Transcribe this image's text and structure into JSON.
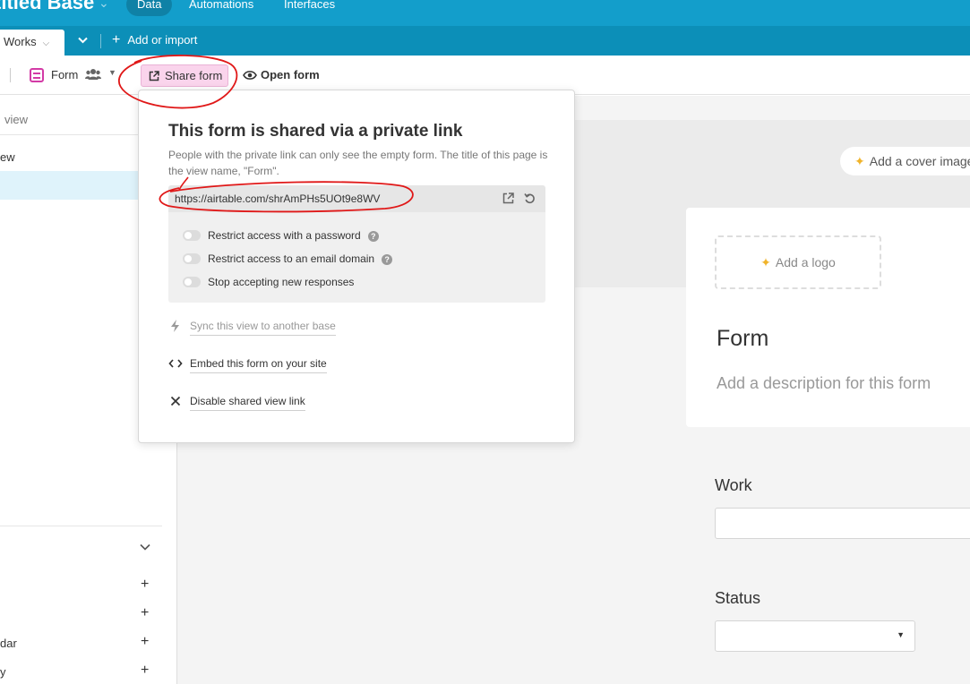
{
  "header": {
    "base_title": "titled Base",
    "nav": [
      "Data",
      "Automations",
      "Interfaces"
    ]
  },
  "tabs": {
    "active_table": "Works",
    "add_import": "Add or import"
  },
  "toolbar": {
    "view_name": "Form",
    "share_label": "Share form",
    "open_label": "Open form"
  },
  "sidebar": {
    "find_placeholder": "view",
    "items": [
      "ew",
      "dar",
      "y"
    ]
  },
  "popover": {
    "title": "This form is shared via a private link",
    "description": "People with the private link can only see the empty form. The title of this page is the view name, \"Form\".",
    "url": "https://airtable.com/shrAmPHs5UOt9e8WV",
    "options": [
      "Restrict access with a password",
      "Restrict access to an email domain",
      "Stop accepting new responses"
    ],
    "actions": {
      "sync": "Sync this view to another base",
      "embed": "Embed this form on your site",
      "disable": "Disable shared view link"
    }
  },
  "form": {
    "cover_button": "Add a cover image",
    "logo_button": "Add a logo",
    "title": "Form",
    "description_placeholder": "Add a description for this form",
    "fields": [
      {
        "label": "Work"
      },
      {
        "label": "Status"
      }
    ]
  },
  "colors": {
    "header": "#139ecb",
    "tabbar": "#0c8fb8",
    "share_button": "#fad4ec",
    "form_icon": "#d33aa6",
    "annotation": "#e01818"
  },
  "icons": [
    "chevron-down-icon",
    "plus-icon",
    "form-view-icon",
    "people-icon",
    "share-icon",
    "eye-icon",
    "external-link-icon",
    "refresh-icon",
    "help-icon",
    "bolt-icon",
    "code-icon",
    "close-icon",
    "sparkle-icon"
  ]
}
